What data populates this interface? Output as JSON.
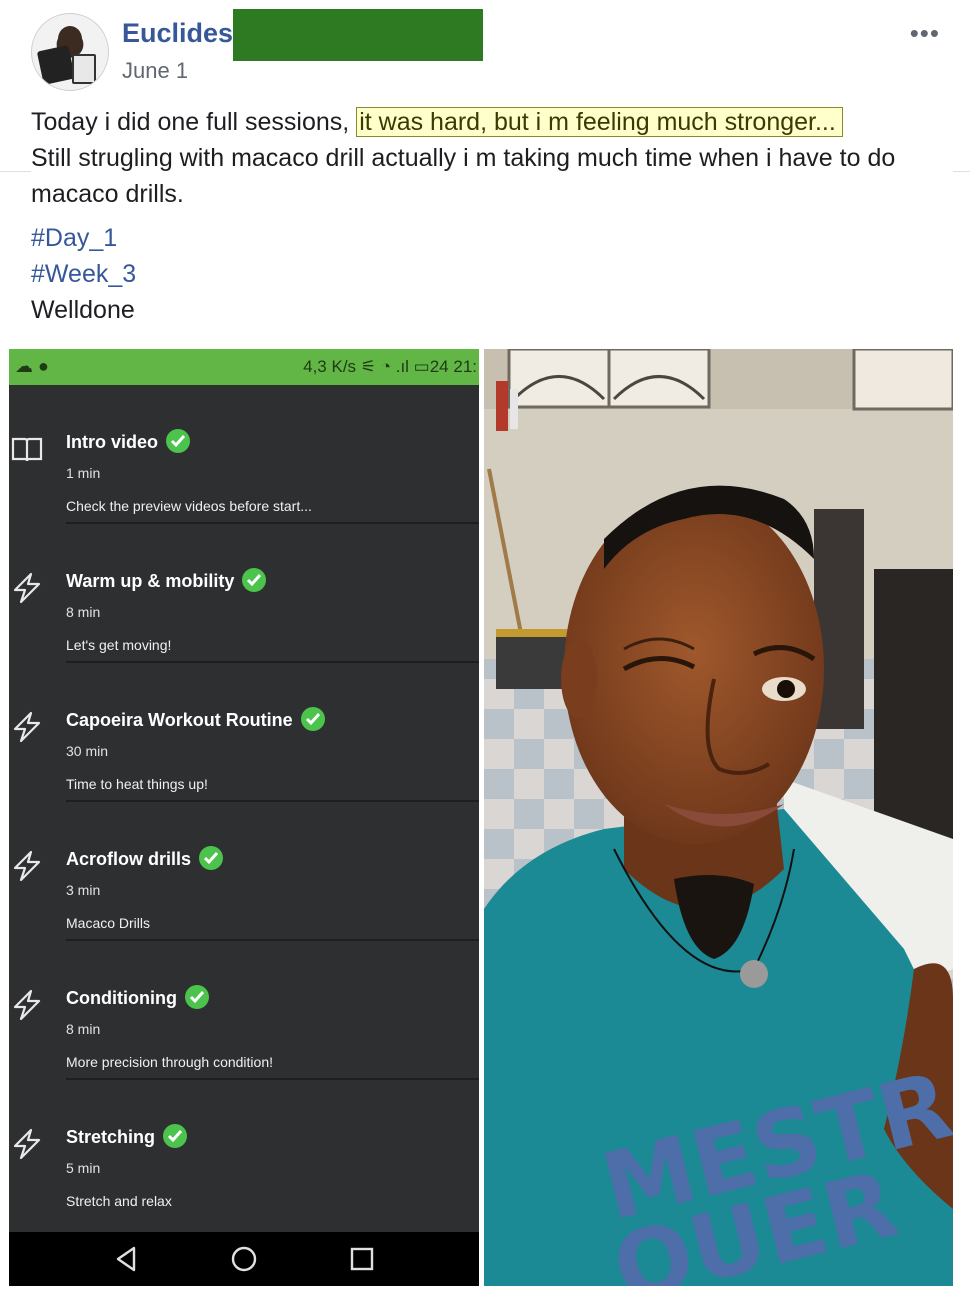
{
  "post": {
    "author": "Euclides",
    "date": "June 1",
    "more_label": "•••",
    "text_part1": "Today i did one full sessions,",
    "text_highlight": "it was hard, but i m feeling much stronger...",
    "text_part2": "Still strugling with macaco drill actually i m taking much time when i have to do macaco drills.",
    "hashtags": [
      "#Day_1",
      "#Week_3"
    ],
    "closing": "Welldone"
  },
  "phone": {
    "status_left": "☁ ●",
    "status_right": "4,3 K/s ⚟ ◔ .ıl ▭24 21:",
    "items": [
      {
        "title": "Intro video",
        "duration": "1 min",
        "description": "Check the preview videos before start...",
        "icon": "book-icon"
      },
      {
        "title": "Warm up & mobility",
        "duration": "8 min",
        "description": "Let's get moving!",
        "icon": "lightning-icon"
      },
      {
        "title": "Capoeira Workout Routine",
        "duration": "30 min",
        "description": "Time to heat things up!",
        "icon": "lightning-icon"
      },
      {
        "title": "Acroflow drills",
        "duration": "3 min",
        "description": "Macaco Drills",
        "icon": "lightning-icon"
      },
      {
        "title": "Conditioning",
        "duration": "8 min",
        "description": "More precision through condition!",
        "icon": "lightning-icon"
      },
      {
        "title": "Stretching",
        "duration": "5 min",
        "description": "Stretch and relax",
        "icon": "lightning-icon"
      }
    ],
    "nav": [
      "back-icon",
      "home-icon",
      "recents-icon"
    ]
  },
  "photo": {
    "shirt_text_line1": "MESTR",
    "shirt_text_line2": "QUER"
  },
  "colors": {
    "link": "#365899",
    "status_green": "#62b646",
    "check_green": "#4cc34c",
    "phone_bg": "#2e2f31",
    "shirt": "#1b8a95"
  }
}
